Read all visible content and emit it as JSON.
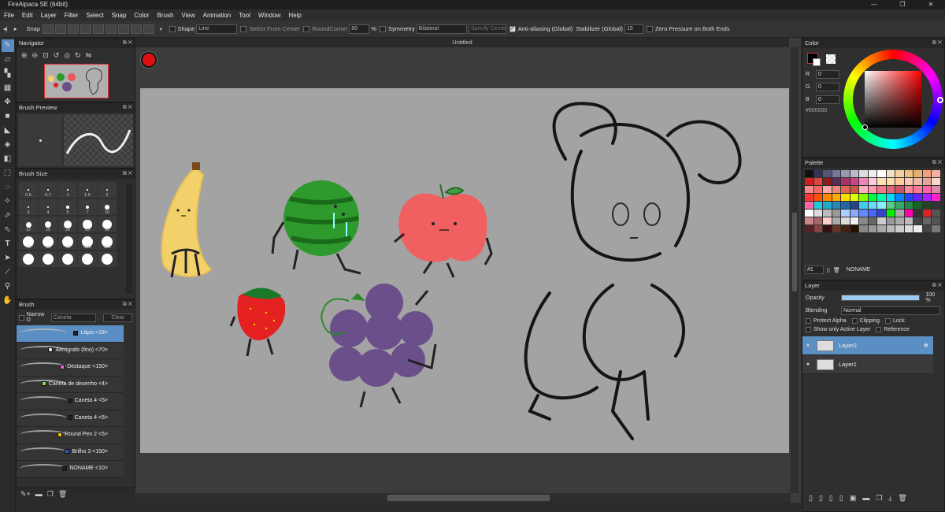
{
  "app": {
    "title": "FireAlpaca SE (64bit)",
    "win_controls": [
      "—",
      "❐",
      "✕"
    ]
  },
  "menu": [
    "File",
    "Edit",
    "Layer",
    "Filter",
    "Select",
    "Snap",
    "Color",
    "Brush",
    "View",
    "Animation",
    "Tool",
    "Window",
    "Help"
  ],
  "toolbar": {
    "snap_label": "Snap",
    "shape_label": "Shape",
    "shape_value": "Line",
    "select_from_center": "Select From Center",
    "round_corner": "RoundCorner",
    "round_value": "80",
    "percent": "%",
    "symmetry_label": "Symmetry",
    "symmetry_value": "Bilateral",
    "specify_center": "Specify Center",
    "antialias_label": "Anti-aliasing (Global)",
    "stabilizer_label": "Stabilizer (Global)",
    "stabilizer_value": "15",
    "zero_pressure": "Zero Pressure on Both Ends"
  },
  "navigator": {
    "title": "Navigator"
  },
  "brush_preview": {
    "title": "Brush Preview"
  },
  "brush_size": {
    "title": "Brush Size",
    "sizes": [
      "0.5",
      "0.7",
      "1",
      "1.5",
      "2",
      "3",
      "4",
      "5",
      "7",
      "10",
      "12",
      "15",
      "20",
      "25",
      "30",
      "40",
      "50",
      "70",
      "100",
      "150",
      "",
      "",
      "",
      "",
      ""
    ]
  },
  "brush": {
    "title": "Brush",
    "narrow_label": "Narrow D",
    "search_placeholder": "Caneta",
    "clear_label": "Clear",
    "items": [
      {
        "name": "Lápis <18>",
        "color": "#222222",
        "active": true
      },
      {
        "name": "Aerógrafo (fino) <70>",
        "color": "#dddddd",
        "active": false
      },
      {
        "name": "Destaque <150>",
        "color": "#ee66cc",
        "active": false
      },
      {
        "name": "Caneta de desenho <4>",
        "color": "#88dd55",
        "active": false
      },
      {
        "name": "Caneta 4 <5>",
        "color": "#222222",
        "active": false
      },
      {
        "name": "Caneta 4 <5>",
        "color": "#222222",
        "active": false
      },
      {
        "name": "Round Pen 2 <5>",
        "color": "#f2c200",
        "active": false
      },
      {
        "name": "Brilho 3 <150>",
        "color": "#3355cc",
        "active": false
      },
      {
        "name": "NONAME <10>",
        "color": "#222222",
        "active": false
      }
    ]
  },
  "document": {
    "tab_title": "Untitled"
  },
  "color": {
    "title": "Color",
    "r_label": "R",
    "g_label": "G",
    "b_label": "B",
    "r": "0",
    "g": "0",
    "b": "0",
    "hex": "#000000",
    "current": "#000000"
  },
  "palette": {
    "title": "Palette",
    "number": "#1",
    "name": "NONAME",
    "colors": [
      "#111111",
      "#333355",
      "#555577",
      "#777799",
      "#9999aa",
      "#bbbbcc",
      "#dddddd",
      "#eeeeee",
      "#ffffff",
      "#f2e0c0",
      "#f5d0a0",
      "#f0c080",
      "#e8b070",
      "#f0a080",
      "#f4b0a0",
      "#cc2020",
      "#dd4444",
      "#8b1a1a",
      "#5a2a5a",
      "#aa3366",
      "#cc4488",
      "#ee88bb",
      "#ffccdd",
      "#ffe0b0",
      "#ffddaa",
      "#ffcc99",
      "#f8c8b0",
      "#f0b8a8",
      "#e8a898",
      "#f8d8c8",
      "#ff8888",
      "#ff6666",
      "#ffaaaa",
      "#ee8877",
      "#dd6655",
      "#cc5544",
      "#ffb0c0",
      "#ff99aa",
      "#ee7788",
      "#dd6677",
      "#cc5566",
      "#ff8899",
      "#ff7799",
      "#ff66aa",
      "#dd88aa",
      "#ff3333",
      "#ff5500",
      "#ff8800",
      "#ffaa00",
      "#ffdd00",
      "#ddff00",
      "#88ff00",
      "#00ff44",
      "#00ffaa",
      "#00ddff",
      "#0088ff",
      "#2244ff",
      "#6622ff",
      "#aa22ff",
      "#ff22cc",
      "#ff66aa",
      "#22ccdd",
      "#22aacc",
      "#2288bb",
      "#2266aa",
      "#224488",
      "#44ccee",
      "#66ddff",
      "#88eeff",
      "#55cc88",
      "#33aa66",
      "#228844",
      "#116622",
      "#224422",
      "#333333",
      "#ffffff",
      "#dddddd",
      "#bbbbbb",
      "#999999",
      "#aaccff",
      "#88aaff",
      "#6688ff",
      "#4466ff",
      "#3344cc",
      "#00ee00",
      "#aaaaaa",
      "#ff00aa",
      "#333333",
      "#dd2222",
      "#555555",
      "#cc8888",
      "#aa6666",
      "#ffcccc",
      "#aaaaaa",
      "#dddddd",
      "#eeeeee",
      "#888888",
      "#666666",
      "#cccccc",
      "#999999",
      "#aaaaaa",
      "#bbbbbb",
      "#444444",
      "#666666",
      "#555555",
      "#552222",
      "#884444",
      "#331111",
      "#663322",
      "#442211",
      "#221100",
      "#888888",
      "#999999",
      "#aaaaaa",
      "#bbbbbb",
      "#cccccc",
      "#dddddd",
      "#eeeeee",
      "#444444",
      "#777777"
    ]
  },
  "layer": {
    "title": "Layer",
    "opacity_label": "Opacity",
    "opacity_value": "100 %",
    "opacity": 1.0,
    "blending_label": "Blending",
    "blending_value": "Normal",
    "protect_alpha": "Protect Alpha",
    "clipping": "Clipping",
    "lock": "Lock",
    "show_only_active": "Show only Active Layer",
    "reference": "Reference",
    "layers": [
      {
        "name": "Layer2",
        "active": true
      },
      {
        "name": "Layer1",
        "active": false
      }
    ]
  }
}
